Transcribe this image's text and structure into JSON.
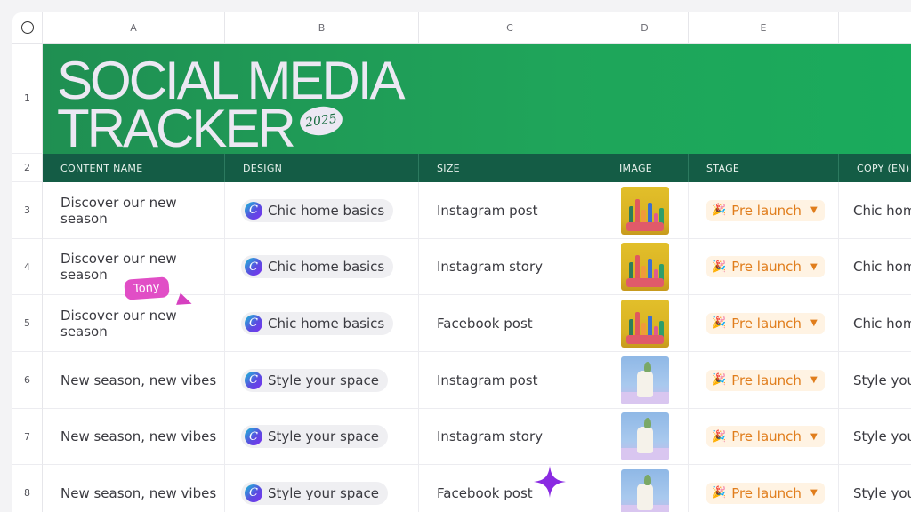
{
  "columns": [
    "A",
    "B",
    "C",
    "D",
    "E"
  ],
  "row_numbers": [
    "1",
    "2",
    "3",
    "4",
    "5",
    "6",
    "7",
    "8"
  ],
  "banner": {
    "title_line1": "SOCIAL MEDIA",
    "title_line2": "TRACKER",
    "year_badge": "2025"
  },
  "headers": {
    "content_name": "CONTENT NAME",
    "design": "DESIGN",
    "size": "SIZE",
    "image": "IMAGE",
    "stage": "STAGE",
    "copy": "COPY (EN)"
  },
  "rows": [
    {
      "content": "Discover our new season",
      "design": "Chic home basics",
      "size": "Instagram post",
      "image": "yellow-still-life-thumbnail",
      "stage": "Pre launch",
      "copy": "Chic hom"
    },
    {
      "content": "Discover our new season",
      "design": "Chic home basics",
      "size": "Instagram story",
      "image": "yellow-still-life-thumbnail",
      "stage": "Pre launch",
      "copy": "Chic hom"
    },
    {
      "content": "Discover our new season",
      "design": "Chic home basics",
      "size": "Facebook post",
      "image": "yellow-still-life-thumbnail",
      "stage": "Pre launch",
      "copy": "Chic hom"
    },
    {
      "content": "New season, new vibes",
      "design": "Style your space",
      "size": "Instagram post",
      "image": "blue-vase-thumbnail",
      "stage": "Pre launch",
      "copy": "Style you"
    },
    {
      "content": "New season, new vibes",
      "design": "Style your space",
      "size": "Instagram story",
      "image": "blue-vase-thumbnail",
      "stage": "Pre launch",
      "copy": "Style you"
    },
    {
      "content": "New season, new vibes",
      "design": "Style your space",
      "size": "Facebook post",
      "image": "blue-vase-thumbnail",
      "stage": "Pre launch",
      "copy": "Style you"
    }
  ],
  "collaborator_cursor": {
    "name": "Tony"
  },
  "icons": {
    "design": "canva-logo-icon",
    "stage": "party-popper-icon",
    "dropdown": "chevron-down-icon",
    "sparkle": "sparkle-icon"
  },
  "colors": {
    "banner_green": "#1fa55a",
    "header_dark_green": "#145c45",
    "stage_orange": "#e07d1c",
    "cursor_pink": "#e14ec6",
    "sparkle_purple": "#8a2be2"
  }
}
